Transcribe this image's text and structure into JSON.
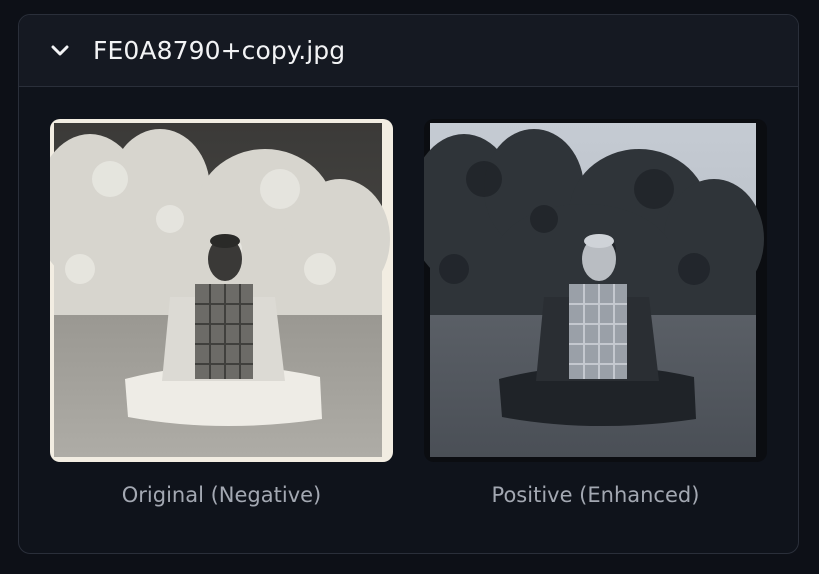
{
  "file_panel": {
    "expanded": true,
    "chevron_icon": "chevron-down-icon",
    "file_name": "FE0A8790+copy.jpg"
  },
  "images": {
    "original": {
      "caption": "Original (Negative)"
    },
    "positive": {
      "caption": "Positive (Enhanced)"
    }
  }
}
